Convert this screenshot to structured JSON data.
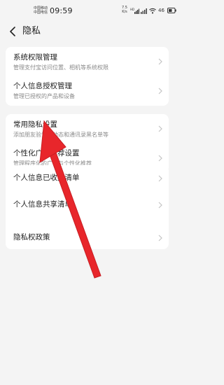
{
  "status_bar": {
    "carrier_lines": [
      "中国移动",
      "中国电信"
    ],
    "time": "09:59",
    "net_speed_value": "7.5",
    "net_speed_unit": "K/s",
    "battery_text": "46"
  },
  "header": {
    "title": "隐私"
  },
  "sections": {
    "permissions": [
      {
        "title": "系统权限管理",
        "subtitle": "管理支付宝访问位置、相机等系统权限"
      },
      {
        "title": "个人信息授权管理",
        "subtitle": "管理已授权的产品和设备"
      }
    ],
    "settings": [
      {
        "title": "常用隐私设置",
        "subtitle": "添加朋友验证、动态和通讯录黑名单等"
      },
      {
        "title": "个性化广告推荐设置",
        "subtitle": "管理程序化的广告与个性化推荐"
      }
    ],
    "documents": [
      {
        "title": "个人信息已收集清单"
      },
      {
        "title": "个人信息共享清单"
      },
      {
        "title": "隐私权政策"
      }
    ]
  },
  "colors": {
    "background": "#f4f4f4",
    "card": "#ffffff",
    "annotation_arrow": "#e8262b"
  },
  "icons": [
    "back-arrow-icon",
    "chevron-right-icon",
    "signal-icon",
    "wifi-icon",
    "battery-icon"
  ]
}
